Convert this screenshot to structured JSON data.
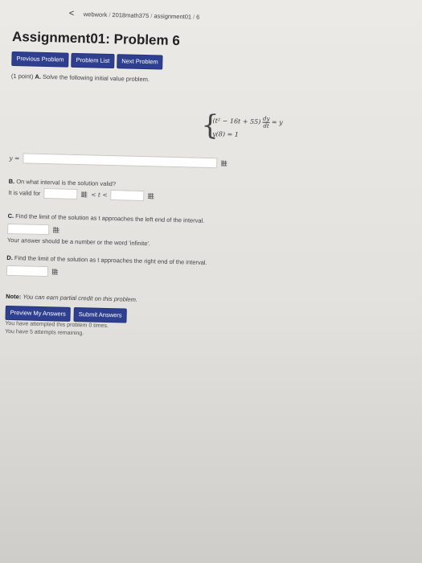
{
  "breadcrumb": {
    "back_label": "<",
    "parts": [
      "webwork",
      "2018math375",
      "assignment01",
      "6"
    ],
    "separator": "/"
  },
  "page_title": "Assignment01: Problem 6",
  "nav_buttons": {
    "previous": "Previous Problem",
    "list": "Problem List",
    "next": "Next Problem"
  },
  "problem": {
    "points": "(1 point)",
    "part_a_label": "A.",
    "part_a_text": "Solve the following initial value problem.",
    "equation_line1_lhs": "(t² − 16t + 55)",
    "equation_deriv_num": "dy",
    "equation_deriv_den": "dt",
    "equation_line1_rhs": "= y",
    "equation_line2": "y(8) = 1",
    "answer_y_label": "y =",
    "part_b_label": "B.",
    "part_b_text": "On what interval is the solution valid?",
    "part_b_sub": "It is valid for",
    "interval_mid": "< t <",
    "part_c_label": "C.",
    "part_c_text": "Find the limit of the solution as t approaches the left end of the interval.",
    "part_c_hint": "Your answer should be a number or the word 'infinite'.",
    "part_d_label": "D.",
    "part_d_text": "Find the limit of the solution as t approaches the right end of the interval."
  },
  "note": {
    "label": "Note:",
    "text": "You can earn partial credit on this problem."
  },
  "submit_buttons": {
    "preview": "Preview My Answers",
    "submit": "Submit Answers"
  },
  "attempts": {
    "line1": "You have attempted this problem 0 times.",
    "line2": "You have 5 attempts remaining."
  }
}
